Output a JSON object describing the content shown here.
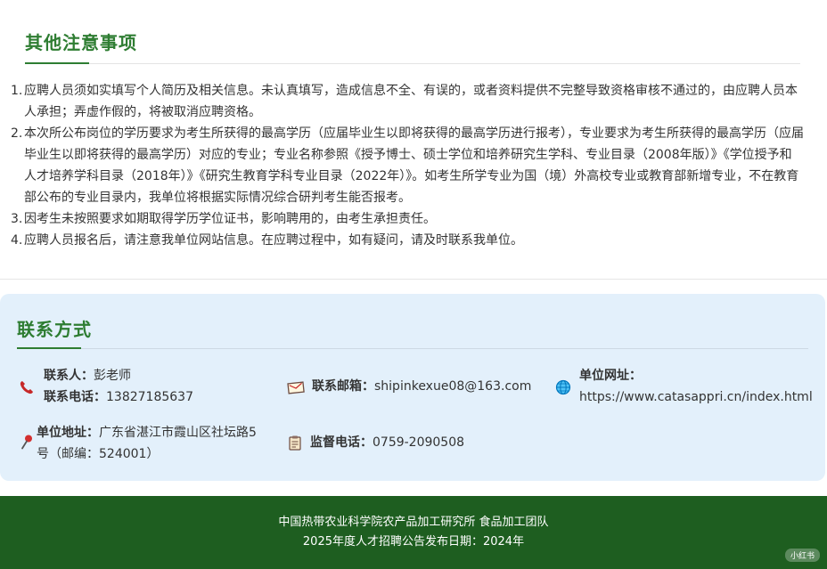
{
  "notes": {
    "title": "其他注意事项",
    "items": [
      {
        "num": "1.",
        "text": "应聘人员须如实填写个人简历及相关信息。未认真填写，造成信息不全、有误的，或者资料提供不完整导致资格审核不通过的，由应聘人员本人承担；弄虚作假的，将被取消应聘资格。"
      },
      {
        "num": "2.",
        "text": "本次所公布岗位的学历要求为考生所获得的最高学历（应届毕业生以即将获得的最高学历进行报考），专业要求为考生所获得的最高学历（应届毕业生以即将获得的最高学历）对应的专业；专业名称参照《授予博士、硕士学位和培养研究生学科、专业目录（2008年版）》《学位授予和人才培养学科目录（2018年）》《研究生教育学科专业目录（2022年）》。如考生所学专业为国（境）外高校专业或教育部新增专业，不在教育部公布的专业目录内，我单位将根据实际情况综合研判考生能否报考。"
      },
      {
        "num": "3.",
        "text": "因考生未按照要求如期取得学历学位证书，影响聘用的，由考生承担责任。"
      },
      {
        "num": "4.",
        "text": "应聘人员报名后，请注意我单位网站信息。在应聘过程中，如有疑问，请及时联系我单位。"
      }
    ]
  },
  "contact": {
    "title": "联系方式",
    "person_label": "联系人：",
    "person_value": "彭老师",
    "phone_label": "联系电话：",
    "phone_value": "13827185637",
    "email_label": "联系邮箱：",
    "email_value": "shipinkexue08@163.com",
    "website_label": "单位网址：",
    "website_value": "https://www.catasappri.cn/index.html",
    "address_label": "单位地址：",
    "address_value": "广东省湛江市霞山区社坛路5号（邮编：524001）",
    "supervise_label": "监督电话：",
    "supervise_value": "0759-2090508"
  },
  "footer": {
    "line1": "中国热带农业科学院农产品加工研究所 食品加工团队",
    "line2": "2025年度人才招聘公告发布日期：2024年",
    "watermark": "小红书"
  },
  "icons": {
    "phone": "telephone-icon",
    "email": "envelope-icon",
    "website": "globe-icon",
    "address": "pushpin-icon",
    "supervise": "clipboard-icon"
  },
  "colors": {
    "accent_green": "#2e7d32",
    "footer_green": "#1e5e20",
    "contact_bg": "#e3f0fb"
  }
}
